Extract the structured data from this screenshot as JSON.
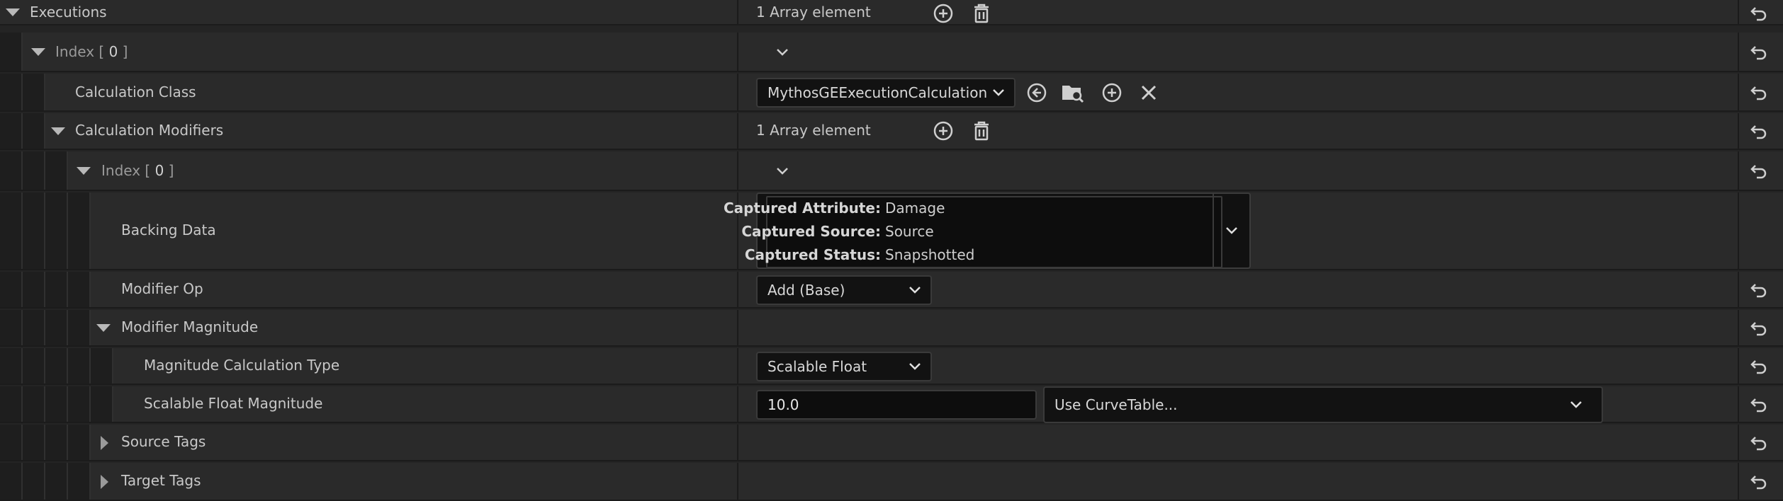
{
  "rows": {
    "executions": {
      "label": "Executions",
      "value": "1 Array element"
    },
    "index0": {
      "prefix": "Index [ ",
      "num": "0",
      "suffix": " ]"
    },
    "calc_class": {
      "label": "Calculation Class",
      "value": "MythosGEExecutionCalculation"
    },
    "calc_modifiers": {
      "label": "Calculation Modifiers",
      "value": "1 Array element"
    },
    "mod_index0": {
      "prefix": "Index [ ",
      "num": "0",
      "suffix": " ]"
    },
    "backing_data": {
      "label": "Backing Data",
      "lines": [
        {
          "key": "Captured Attribute:",
          "value": "Damage"
        },
        {
          "key": "Captured Source:",
          "value": "Source"
        },
        {
          "key": "Captured Status:",
          "value": "Snapshotted"
        }
      ]
    },
    "modifier_op": {
      "label": "Modifier Op",
      "value": "Add (Base)"
    },
    "modifier_magnitude": {
      "label": "Modifier Magnitude"
    },
    "mag_calc_type": {
      "label": "Magnitude Calculation Type",
      "value": "Scalable Float"
    },
    "scalable_float": {
      "label": "Scalable Float Magnitude",
      "value": "10.0",
      "curve_table": "Use CurveTable..."
    },
    "source_tags": {
      "label": "Source Tags"
    },
    "target_tags": {
      "label": "Target Tags"
    }
  },
  "icons": {
    "add": "plus-circle-icon",
    "delete": "trash-icon",
    "reset": "reset-to-default-icon",
    "expand": "chevron-down-icon",
    "use_selected": "arrow-left-circle-icon",
    "browse": "folder-search-icon",
    "clear": "close-icon"
  },
  "colors": {
    "background": "#242424",
    "row": "#2a2a2a",
    "field": "#121212",
    "text": "#c8c8c8"
  }
}
